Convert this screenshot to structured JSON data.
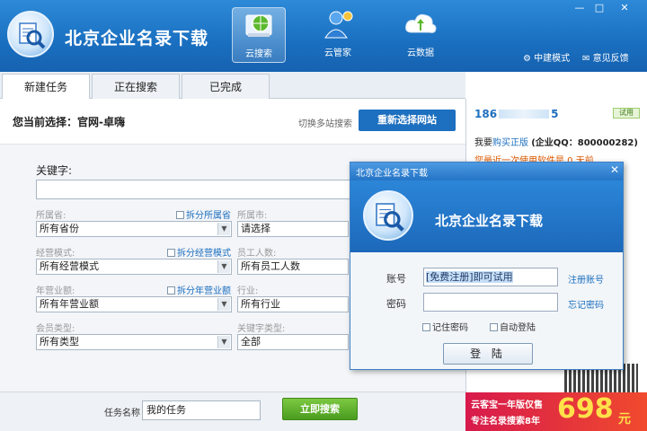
{
  "header": {
    "app_title": "北京企业名录下载",
    "tools": [
      {
        "label": "云搜索",
        "icon": "radar-search-icon"
      },
      {
        "label": "云管家",
        "icon": "manager-person-icon"
      },
      {
        "label": "云数据",
        "icon": "cloud-data-icon"
      }
    ],
    "links": {
      "mode": "中建模式",
      "feedback": "意见反馈"
    }
  },
  "tabs": [
    "新建任务",
    "正在搜索",
    "已完成"
  ],
  "main": {
    "current_select": "您当前选择：官网-卓嗨",
    "switch_link": "切换多站搜索",
    "reselect_button": "重新选择网站"
  },
  "form": {
    "keyword_label": "关键字:",
    "province": {
      "label": "所属省:",
      "value": "所有省份",
      "split": "拆分所属省"
    },
    "city": {
      "label": "所属市:",
      "value": "请选择"
    },
    "business_mode": {
      "label": "经营模式:",
      "value": "所有经营模式",
      "split": "拆分经营模式"
    },
    "employees": {
      "label": "员工人数:",
      "value": "所有员工人数"
    },
    "turnover": {
      "label": "年营业额:",
      "value": "所有年营业额",
      "split": "拆分年营业额"
    },
    "industry": {
      "label": "行业:",
      "value": "所有行业"
    },
    "member_type": {
      "label": "会员类型:",
      "value": "所有类型"
    },
    "keyword_type": {
      "label": "关键字类型:",
      "value": "全部"
    }
  },
  "bottom": {
    "task_label": "任务名称",
    "task_value": "我的任务",
    "search_button": "立即搜索"
  },
  "right": {
    "phone_prefix": "186",
    "phone_suffix": "5",
    "badge": "试用",
    "buy_prefix": "我要",
    "buy_link": "购买正版",
    "qq": "(企业QQ：800000282)",
    "note": "您最近一次使用软件是 0 天前",
    "promo_line1": "云客宝一年版仅售",
    "promo_line2": "专注名录搜索8年",
    "promo_price": "698",
    "promo_unit": "元"
  },
  "dialog": {
    "title": "北京企业名录下载",
    "app_title": "北京企业名录下载",
    "account_label": "账号",
    "account_value": "[免费注册]即可试用",
    "password_label": "密码",
    "register_link": "注册账号",
    "forgot_link": "忘记密码",
    "remember": "记住密码",
    "auto_login": "自动登陆",
    "login_button": "登 陆"
  }
}
